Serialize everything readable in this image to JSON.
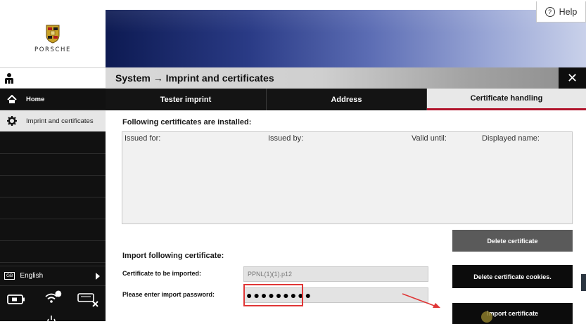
{
  "header": {
    "brand": "PORSCHE",
    "help_label": "Help",
    "title": "System → Imprint and certificates",
    "close_label": "✕"
  },
  "sidebar": {
    "items": [
      {
        "label": "Home",
        "icon": "home-icon"
      },
      {
        "label": "Imprint and certificates",
        "icon": "gear-icon"
      }
    ],
    "language": {
      "badge": "GB",
      "label": "English"
    },
    "status": {
      "badge": "!"
    }
  },
  "tabs": [
    {
      "label": "Tester imprint",
      "active": false
    },
    {
      "label": "Address",
      "active": false
    },
    {
      "label": "Certificate handling",
      "active": true
    }
  ],
  "certificates": {
    "heading": "Following certificates are installed:",
    "columns": [
      "Issued for:",
      "Issued by:",
      "Valid until:",
      "Displayed name:"
    ],
    "rows": [],
    "delete_button": "Delete certificate"
  },
  "import": {
    "heading": "Import following certificate:",
    "file_label": "Certificate to be imported:",
    "file_value": "PPNL(1)(1).p12",
    "password_label": "Please enter import password:",
    "password_value": "●●●●●●●●●",
    "delete_cookies_button": "Delete certificate cookies.",
    "import_button": "Import certificate"
  },
  "colors": {
    "accent_red": "#b0132b",
    "annotation_red": "#e03636",
    "banner_dark": "#0d1a52"
  }
}
